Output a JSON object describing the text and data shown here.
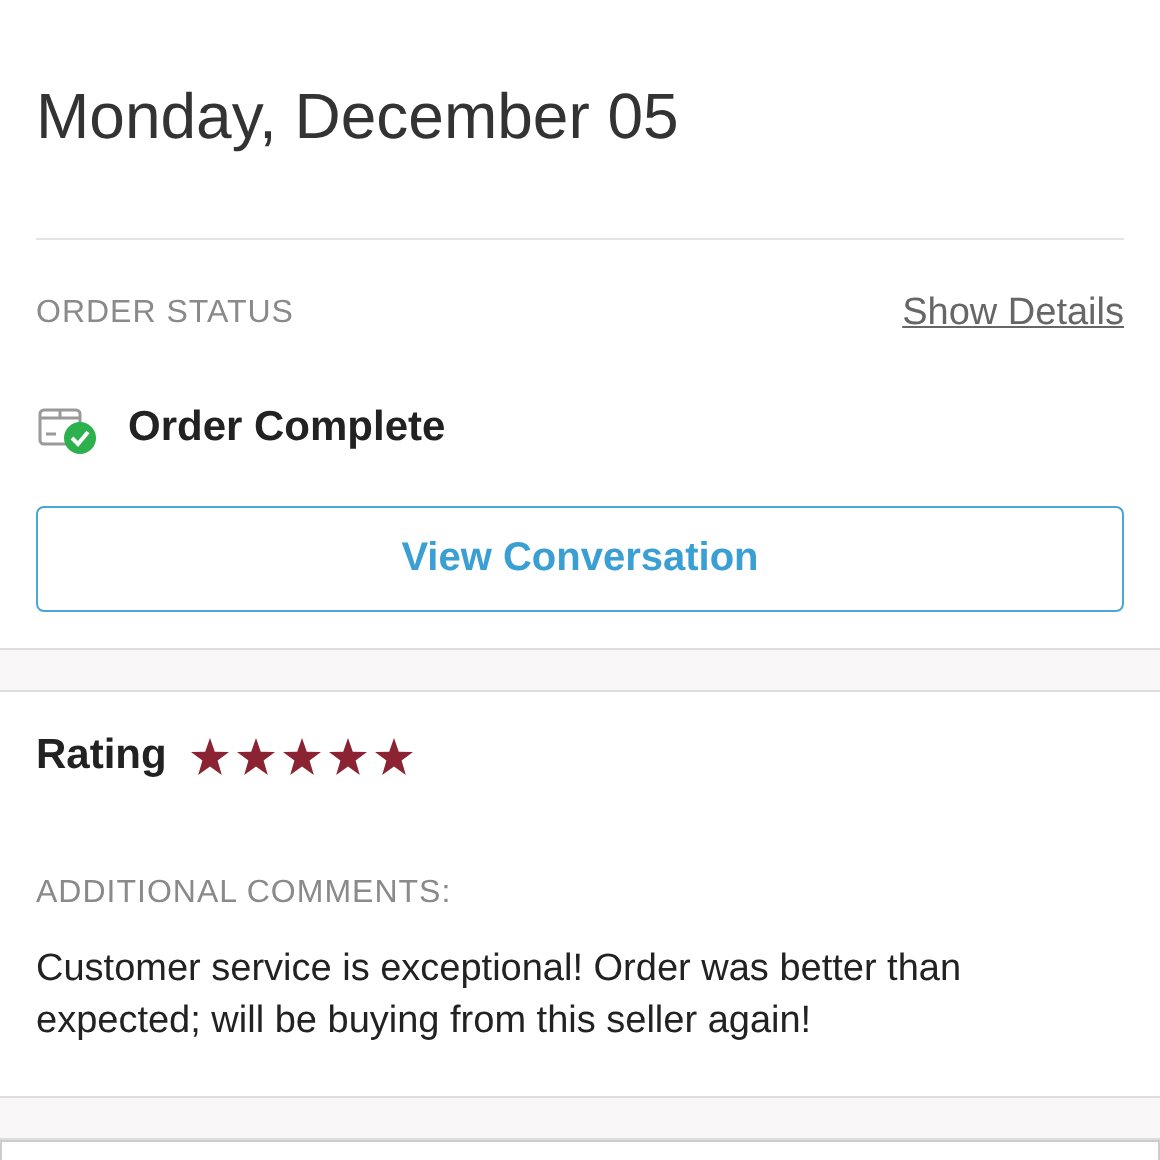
{
  "date": "Monday, December 05",
  "order_status": {
    "label": "ORDER STATUS",
    "link": "Show Details",
    "status": "Order Complete",
    "button": "View Conversation"
  },
  "rating": {
    "label": "Rating",
    "stars": 5
  },
  "comments": {
    "label": "ADDITIONAL COMMENTS:",
    "text": "Customer service is exceptional! Order was better than expected; will be buying from this seller again!"
  }
}
